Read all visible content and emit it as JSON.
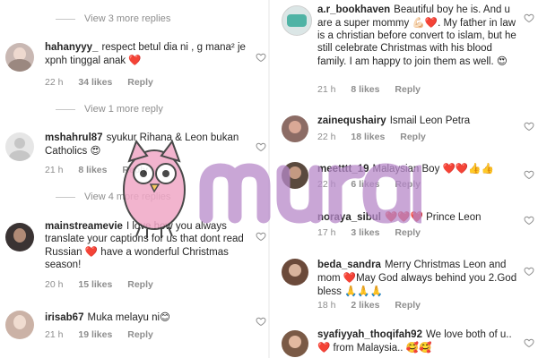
{
  "left": {
    "view_more_1": "View 3 more replies",
    "c1": {
      "user": "hahanyyy_",
      "text": "respect betul dia ni , g mana² je xpnh tinggal anak",
      "emoji": "❤️",
      "time": "22 h",
      "likes": "34 likes",
      "reply": "Reply"
    },
    "view_more_2": "View 1 more reply",
    "c2": {
      "user": "mshahrul87",
      "text": "syukur Rihana & Leon bukan Catholics",
      "emoji": "😍",
      "time": "21 h",
      "likes": "8 likes",
      "reply": "Reply"
    },
    "view_more_3": "View 4 more replies",
    "c3": {
      "user": "mainstreamevie",
      "text_a": "I love how you always translate your captions for us that dont read Russian",
      "emoji": "❤️",
      "text_b": "have a wonderful Christmas season!",
      "time": "20 h",
      "likes": "15 likes",
      "reply": "Reply"
    },
    "c4": {
      "user": "irisab67",
      "text": "Muka melayu ni",
      "emoji": "😊",
      "time": "21 h",
      "likes": "19 likes",
      "reply": "Reply"
    }
  },
  "right": {
    "c1": {
      "user": "a.r_bookhaven",
      "text_a": "Beautiful boy he is. And u are a super mommy",
      "emoji_a": "💪🏻❤️",
      "text_b": ". My father in law is a christian before convert to islam, but he still celebrate Christmas with his blood family. I am happy to join them as well.",
      "emoji_b": "😍",
      "time": "21 h",
      "likes": "8 likes",
      "reply": "Reply"
    },
    "c2": {
      "user": "zainequshairy",
      "text": "Ismail Leon Petra",
      "time": "22 h",
      "likes": "18 likes",
      "reply": "Reply"
    },
    "c3": {
      "user": "meetttt_19",
      "text": "Malaysian Boy",
      "emoji": "❤️❤️👍👍",
      "time": "22 h",
      "likes": "6 likes",
      "reply": "Reply"
    },
    "c4": {
      "user": "noraya_sibul",
      "emoji": "❤️❤️❤️",
      "text": "Prince Leon",
      "time": "17 h",
      "likes": "3 likes",
      "reply": "Reply"
    },
    "c5": {
      "user": "beda_sandra",
      "text_a": "Merry Christmas Leon and mom",
      "emoji_a": "❤️",
      "text_b": "May God always behind you 2.God bless",
      "emoji_b": "🙏🙏🙏",
      "time": "18 h",
      "likes": "2 likes",
      "reply": "Reply"
    },
    "c6": {
      "user": "syafiyyah_thoqifah92",
      "text_a": "We love both of u..",
      "emoji_a": "❤️",
      "text_b": "from Malaysia..",
      "emoji_b": "🥰🥰"
    }
  },
  "watermark": {
    "brand": "murai"
  },
  "colors": {
    "heart": "#d41f2d",
    "meta": "#8e8e8e",
    "watermark": "#b789c9",
    "owl": "#f0a7c6"
  },
  "icons": [
    "heart-outline-icon",
    "owl-mascot-icon"
  ]
}
